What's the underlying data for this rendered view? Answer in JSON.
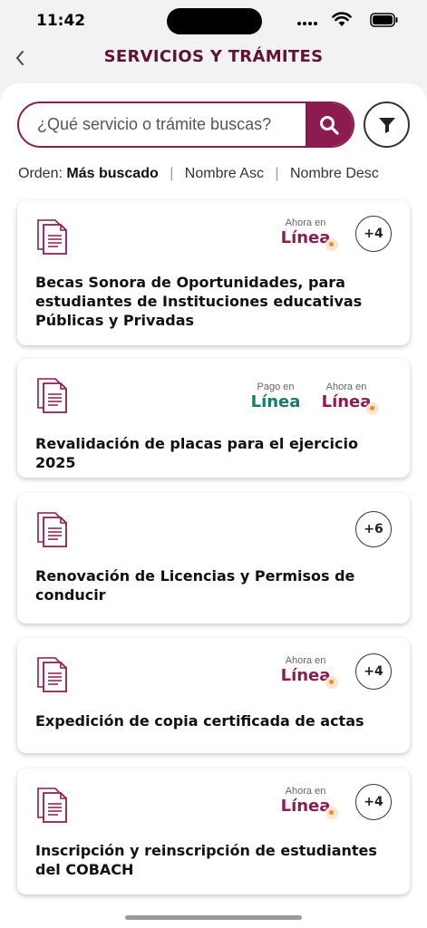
{
  "status_bar": {
    "time": "11:42"
  },
  "header": {
    "title": "SERVICIOS Y TRÁMITES"
  },
  "search": {
    "placeholder": "¿Qué servicio o trámite buscas?"
  },
  "order": {
    "label": "Orden:",
    "options": [
      "Más buscado",
      "Nombre Asc",
      "Nombre Desc"
    ],
    "selected": "Más buscado"
  },
  "badges": {
    "ahora_small": "Ahora en",
    "pago_small": "Pago en",
    "linea": "Línea"
  },
  "services": [
    {
      "title": "Becas Sonora de Oportunidades, para estudiantes de Instituciones educativas Públicas y Privadas",
      "more": "+4",
      "badges": [
        "ahora-en-linea"
      ]
    },
    {
      "title": "Revalidación de placas para el ejercicio 2025",
      "more": "",
      "badges": [
        "pago-en-linea",
        "ahora-en-linea"
      ]
    },
    {
      "title": "Renovación de Licencias y Permisos de conducir",
      "more": "+6",
      "badges": []
    },
    {
      "title": "Expedición de copia certificada de actas",
      "more": "+4",
      "badges": [
        "ahora-en-linea"
      ]
    },
    {
      "title": "Inscripción y reinscripción de estudiantes del COBACH",
      "more": "+4",
      "badges": [
        "ahora-en-linea"
      ]
    }
  ],
  "colors": {
    "brand": "#8c1c4f",
    "title": "#5d1436",
    "teal": "#1a7a6c",
    "accent_dot": "#f08a24"
  },
  "icons": [
    "chevron-left-icon",
    "search-icon",
    "filter-icon",
    "document-icon",
    "wifi-icon",
    "battery-icon",
    "signal-icon"
  ]
}
